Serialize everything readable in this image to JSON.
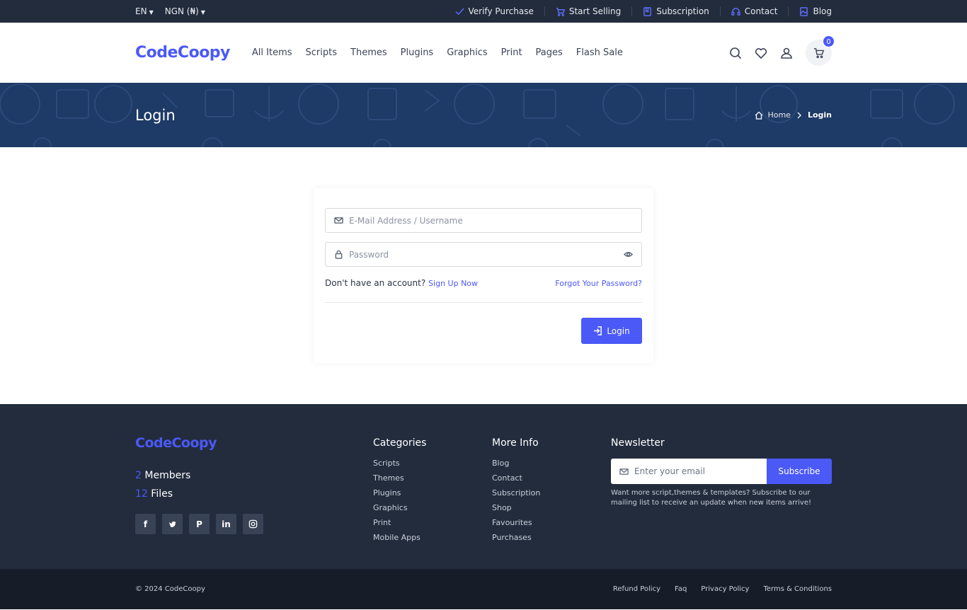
{
  "topbar": {
    "language": "EN",
    "currency": "NGN (₦)",
    "links": [
      {
        "label": "Verify Purchase",
        "icon": "check-icon"
      },
      {
        "label": "Start Selling",
        "icon": "cart-icon"
      },
      {
        "label": "Subscription",
        "icon": "book-icon"
      },
      {
        "label": "Contact",
        "icon": "headset-icon"
      },
      {
        "label": "Blog",
        "icon": "image-icon"
      }
    ]
  },
  "header": {
    "logo": "CodeCoopy",
    "nav": [
      "All Items",
      "Scripts",
      "Themes",
      "Plugins",
      "Graphics",
      "Print",
      "Pages",
      "Flash Sale"
    ],
    "cart_count": "0"
  },
  "banner": {
    "title": "Login",
    "breadcrumb_home": "Home",
    "breadcrumb_current": "Login"
  },
  "login": {
    "email_placeholder": "E-Mail Address / Username",
    "password_placeholder": "Password",
    "no_account_text": "Don't have an account?",
    "signup_link": "Sign Up Now",
    "forgot_link": "Forgot Your Password?",
    "login_button": "Login"
  },
  "footer": {
    "logo": "CodeCoopy",
    "members_count": "2",
    "members_label": "Members",
    "files_count": "12",
    "files_label": "Files",
    "categories_title": "Categories",
    "categories": [
      "Scripts",
      "Themes",
      "Plugins",
      "Graphics",
      "Print",
      "Mobile Apps"
    ],
    "more_info_title": "More Info",
    "more_info": [
      "Blog",
      "Contact",
      "Subscription",
      "Shop",
      "Favourites",
      "Purchases"
    ],
    "newsletter_title": "Newsletter",
    "newsletter_placeholder": "Enter your email",
    "subscribe_button": "Subscribe",
    "newsletter_text": "Want more script,themes & templates? Subscribe to our mailing list to receive an update when new items arrive!",
    "copyright": "© 2024 CodeCoopy",
    "bottom_links": [
      "Refund Policy",
      "Faq",
      "Privacy Policy",
      "Terms & Conditions"
    ]
  },
  "colors": {
    "accent": "#4b59f7",
    "topbar_bg": "#232c3d",
    "banner_bg": "#1e3a66",
    "footer_bg": "#232c3d",
    "bottombar_bg": "#171d28"
  }
}
